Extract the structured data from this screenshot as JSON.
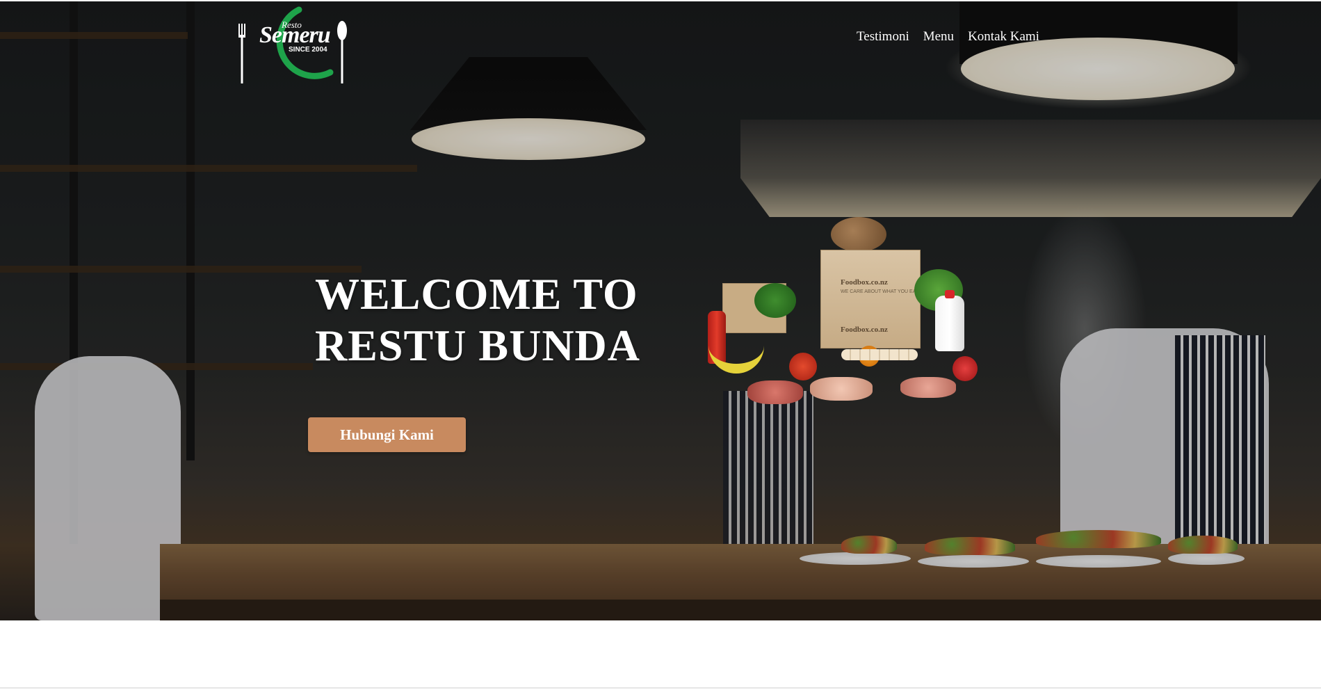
{
  "logo": {
    "top_text": "Resto",
    "brand_text": "Semeru",
    "tagline": "SINCE 2004"
  },
  "nav": {
    "items": [
      {
        "label": "Testimoni"
      },
      {
        "label": "Menu"
      },
      {
        "label": "Kontak Kami"
      }
    ]
  },
  "hero": {
    "heading_line1": "WELCOME TO",
    "heading_line2": "RESTU BUNDA",
    "cta_label": "Hubungi Kami",
    "foodbox_label": "Foodbox.co.nz",
    "foodbox_tagline": "WE CARE ABOUT WHAT YOU EAT"
  },
  "colors": {
    "cta_bg": "#c88a5f",
    "logo_green": "#1ea34a",
    "text_white": "#ffffff"
  },
  "icons": {
    "logo_fork": "fork-icon",
    "logo_spoon": "spoon-icon"
  }
}
